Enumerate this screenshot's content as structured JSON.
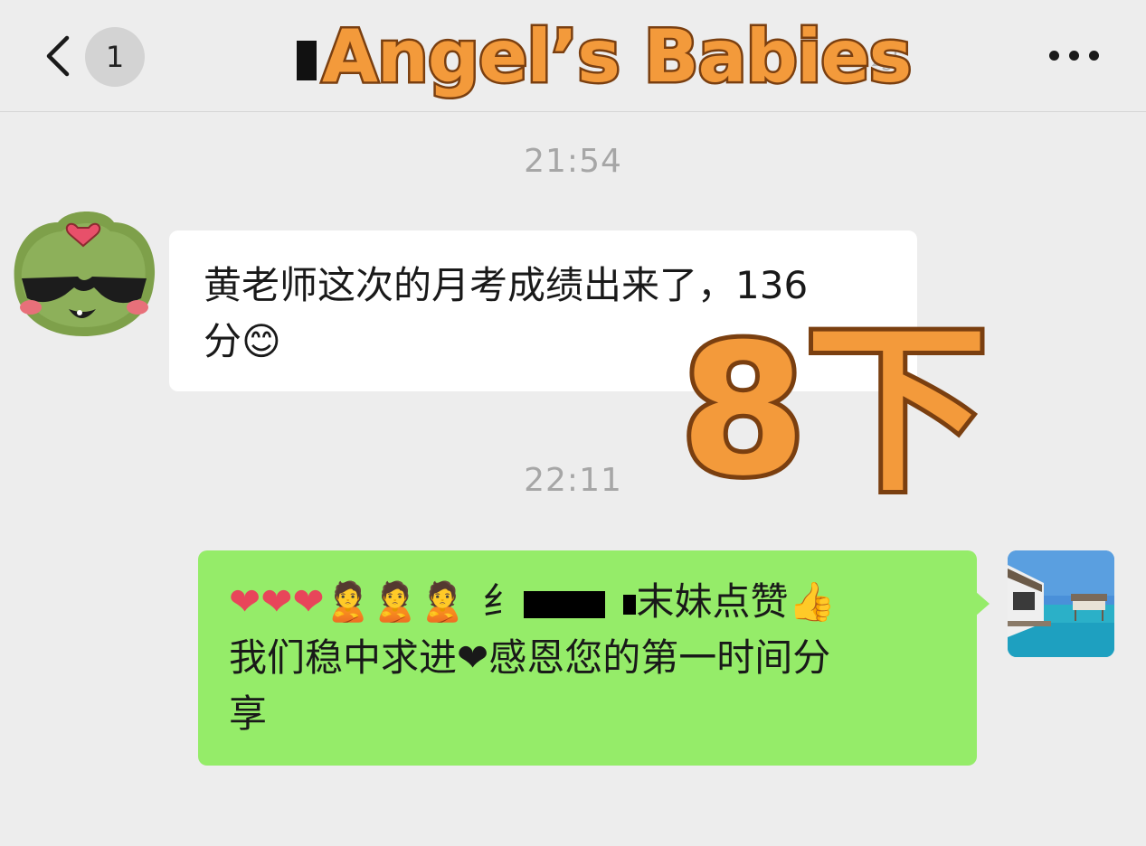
{
  "header": {
    "unread_count": "1",
    "title_overlay": "Angel’s Babies"
  },
  "messages": [
    {
      "timestamp": "21:54",
      "direction": "incoming",
      "text_line1": "黄老师这次的月考成绩出来了，136",
      "text_line2": "分😊"
    },
    {
      "timestamp": "22:11",
      "direction": "outgoing",
      "line1_hearts": "❤❤❤",
      "line1_people": "🙎🙎🙎",
      "line1_pre": "纟",
      "line1_post": "末妹点赞👍",
      "line2": "我们稳中求进❤感恩您的第一时间分",
      "line3": "享"
    }
  ],
  "overlay_sticker": "8下",
  "icons": {
    "back": "chevron-left-icon",
    "mute": "bell-slash-icon",
    "more": "more-dots-icon"
  },
  "colors": {
    "background": "#ededed",
    "outgoing_bubble": "#95ec69",
    "incoming_bubble": "#ffffff",
    "overlay_fill": "#f39a3b",
    "overlay_stroke": "#7a3f10"
  }
}
